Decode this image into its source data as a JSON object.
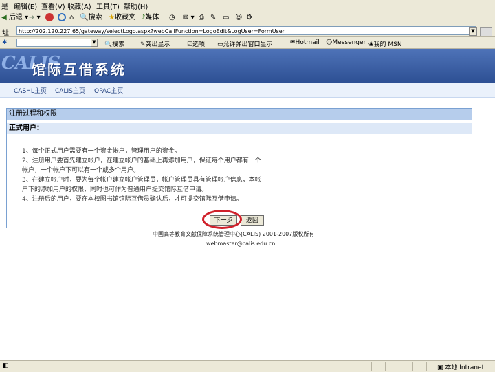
{
  "menubar": {
    "items": [
      "是",
      "编辑(E)",
      "查看(V)",
      "收藏(A)",
      "工具(T)",
      "帮助(H)"
    ]
  },
  "toolbar": {
    "back": "后退",
    "search": "搜索",
    "favorites": "收藏夹",
    "media": "媒体"
  },
  "addressbar": {
    "label": "址",
    "url": "http://202.120.227.65/gateway/selectLogo.aspx?webCallFunction=LogoEdit&LogUser=FormUser"
  },
  "linksbar": {
    "search": "搜索",
    "highlight": "突出显示",
    "options": "选项",
    "popup": "允许弹出窗口显示",
    "hotmail": "Hotmail",
    "messenger": "Messenger",
    "mymsn": "我的 MSN"
  },
  "banner": {
    "logo": "CALIS",
    "title": "馆际互借系统"
  },
  "nav": {
    "items": [
      "CASHL主页",
      "CALIS主页",
      "OPAC主页"
    ]
  },
  "panel": {
    "heading": "注册过程和权限",
    "subheading": "正式用户：",
    "rules": [
      "1、每个正式用户需要有一个资金帐户，管理用户的资金。",
      "2、注册用户要首先建立帐户，在建立帐户的基础上再添加用户，保证每个用户都有一个",
      "      帐户，一个帐户下可以有一个或多个用户。",
      "3、在建立帐户时，要为每个帐户建立帐户管理员，帐户管理员具有管理帐户信息，本帐",
      "      户下的添加用户的权限，同时也可作为普通用户提交馆际互借申请。",
      "4、注册后的用户，要在本校图书馆馆际互借员确认后，才可提交馆际互借申请。"
    ],
    "next_button": "下一步",
    "back_button": "返回"
  },
  "footer": {
    "copyright": "中国高等教育文献保障系统管理中心(CALIS) 2001-2007版权所有",
    "email": "webmaster@calis.edu.cn"
  },
  "statusbar": {
    "zone": "本地 Intranet"
  }
}
